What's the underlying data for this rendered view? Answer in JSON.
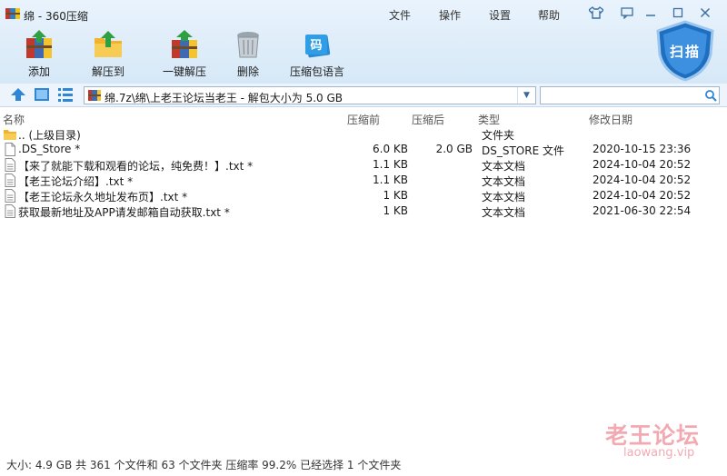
{
  "window": {
    "title": "绵 - 360压缩"
  },
  "menu": [
    "文件",
    "操作",
    "设置",
    "帮助"
  ],
  "toolbar": {
    "add": "添加",
    "extract_to": "解压到",
    "one_click_extract": "一键解压",
    "delete": "删除",
    "language": "压缩包语言",
    "scan": "扫描"
  },
  "address": {
    "path": "绵.7z\\绵\\上老王论坛当老王 - 解包大小为 5.0 GB",
    "search_placeholder": ""
  },
  "columns": {
    "name": "名称",
    "packed": "压缩前",
    "size": "压缩后",
    "type": "类型",
    "modified": "修改日期"
  },
  "files": [
    {
      "icon": "folder-up-icon",
      "name": ".. (上级目录)",
      "packed": "",
      "size": "",
      "type": "文件夹",
      "modified": ""
    },
    {
      "icon": "file-icon",
      "name": ".DS_Store *",
      "packed": "6.0 KB",
      "size": "2.0 GB",
      "type": "DS_STORE 文件",
      "modified": "2020-10-15 23:36"
    },
    {
      "icon": "text-file-icon",
      "name": "【来了就能下载和观看的论坛，纯免费！】.txt *",
      "packed": "1.1 KB",
      "size": "",
      "type": "文本文档",
      "modified": "2024-10-04 20:52"
    },
    {
      "icon": "text-file-icon",
      "name": "【老王论坛介绍】.txt *",
      "packed": "1.1 KB",
      "size": "",
      "type": "文本文档",
      "modified": "2024-10-04 20:52"
    },
    {
      "icon": "text-file-icon",
      "name": "【老王论坛永久地址发布页】.txt *",
      "packed": "1 KB",
      "size": "",
      "type": "文本文档",
      "modified": "2024-10-04 20:52"
    },
    {
      "icon": "text-file-icon",
      "name": "获取最新地址及APP请发邮箱自动获取.txt *",
      "packed": "1 KB",
      "size": "",
      "type": "文本文档",
      "modified": "2021-06-30 22:54"
    }
  ],
  "watermark": {
    "title": "老王论坛",
    "url": "laowang.vip"
  },
  "status": "大小: 4.9 GB 共 361 个文件和 63 个文件夹 压缩率 99.2% 已经选择 1 个文件夹",
  "colors": {
    "accent": "#1e78c8",
    "header_bg": "#dcebf8",
    "watermark": "#f19ba5"
  }
}
